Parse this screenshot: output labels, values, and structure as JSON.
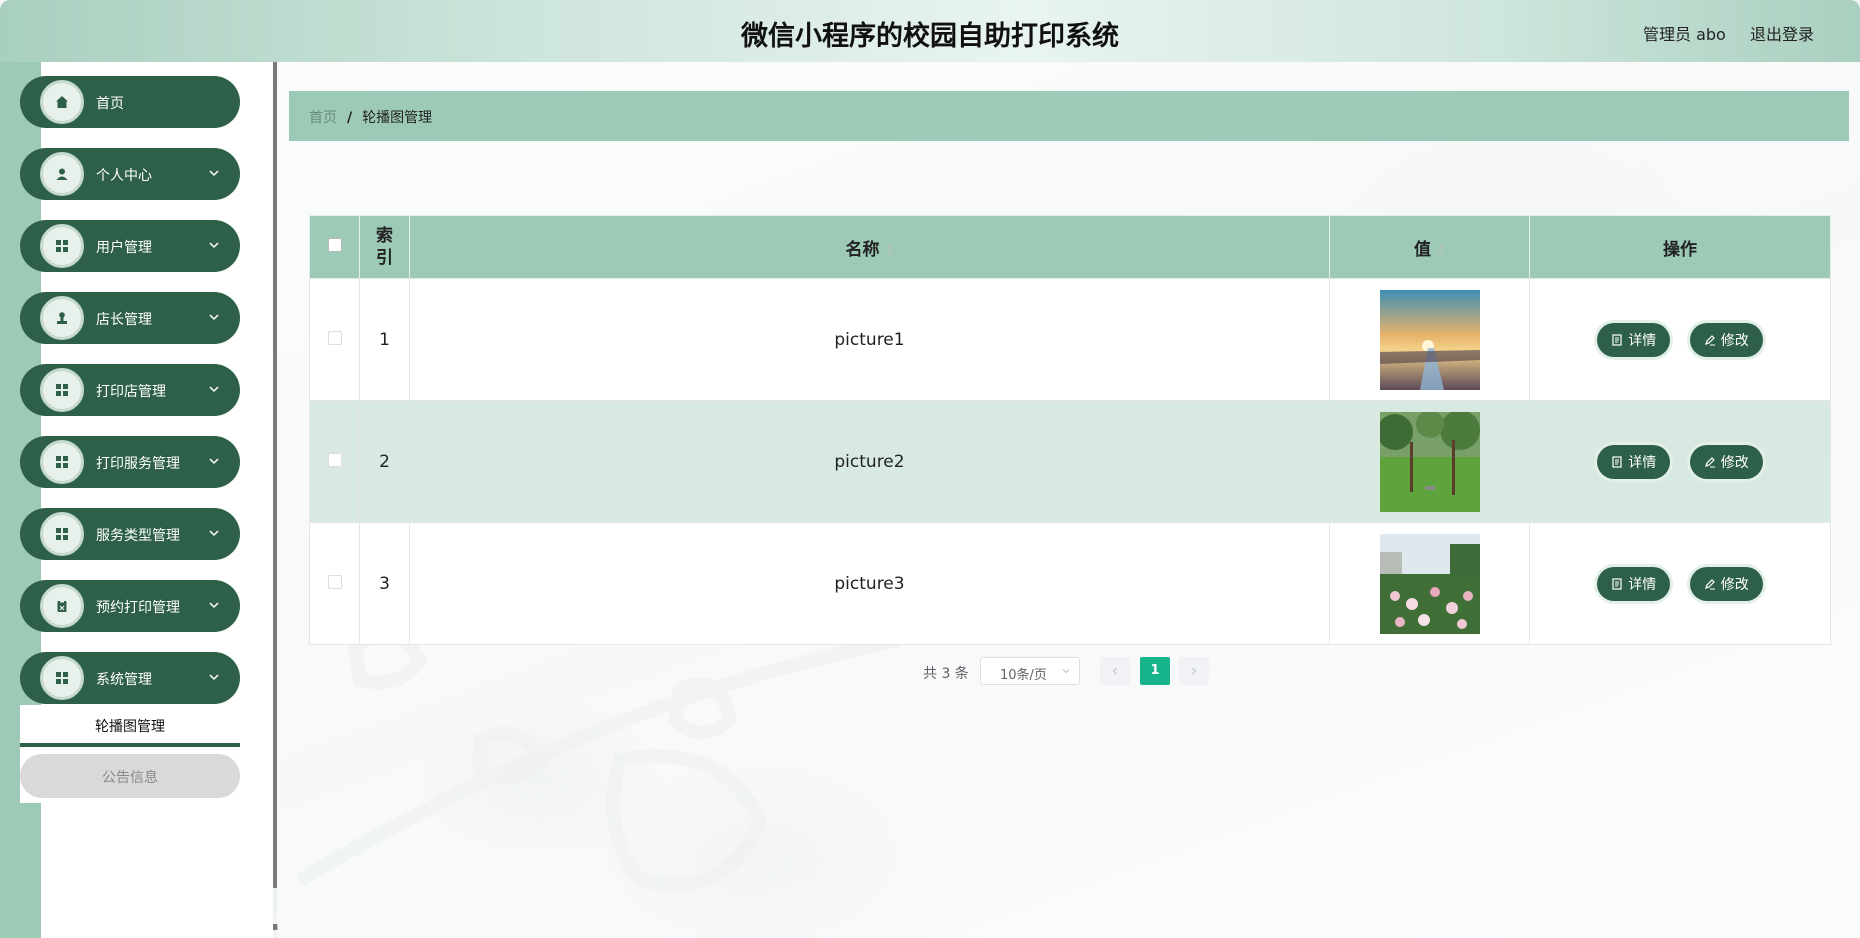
{
  "header": {
    "title": "微信小程序的校园自助打印系统",
    "admin": "管理员 abo",
    "logout": "退出登录"
  },
  "sidebar": {
    "items": [
      {
        "label": "首页",
        "icon": "home-icon",
        "expandable": false
      },
      {
        "label": "个人中心",
        "icon": "user-icon",
        "expandable": true
      },
      {
        "label": "用户管理",
        "icon": "grid-icon",
        "expandable": true
      },
      {
        "label": "店长管理",
        "icon": "person-stamp-icon",
        "expandable": true
      },
      {
        "label": "打印店管理",
        "icon": "grid-icon",
        "expandable": true
      },
      {
        "label": "打印服务管理",
        "icon": "grid-icon",
        "expandable": true
      },
      {
        "label": "服务类型管理",
        "icon": "grid-icon",
        "expandable": true
      },
      {
        "label": "预约打印管理",
        "icon": "clipboard-icon",
        "expandable": true
      },
      {
        "label": "系统管理",
        "icon": "grid-icon",
        "expandable": true
      }
    ],
    "submenu": {
      "active": "轮播图管理",
      "other": "公告信息"
    }
  },
  "breadcrumb": {
    "home": "首页",
    "separator": "/",
    "current": "轮播图管理"
  },
  "table": {
    "headers": {
      "index": "索引",
      "name": "名称",
      "value": "值",
      "actions": "操作"
    },
    "rows": [
      {
        "index": "1",
        "name": "picture1",
        "image": "sunset-road"
      },
      {
        "index": "2",
        "name": "picture2",
        "image": "park-lawn"
      },
      {
        "index": "3",
        "name": "picture3",
        "image": "flower-garden"
      }
    ],
    "detail_label": "详情",
    "edit_label": "修改"
  },
  "pagination": {
    "total": "共 3 条",
    "page_size": "10条/页",
    "current_page": "1"
  },
  "colors": {
    "accent": "#2e6049",
    "header_green": "#9ccab6",
    "active_page": "#17b38b"
  }
}
